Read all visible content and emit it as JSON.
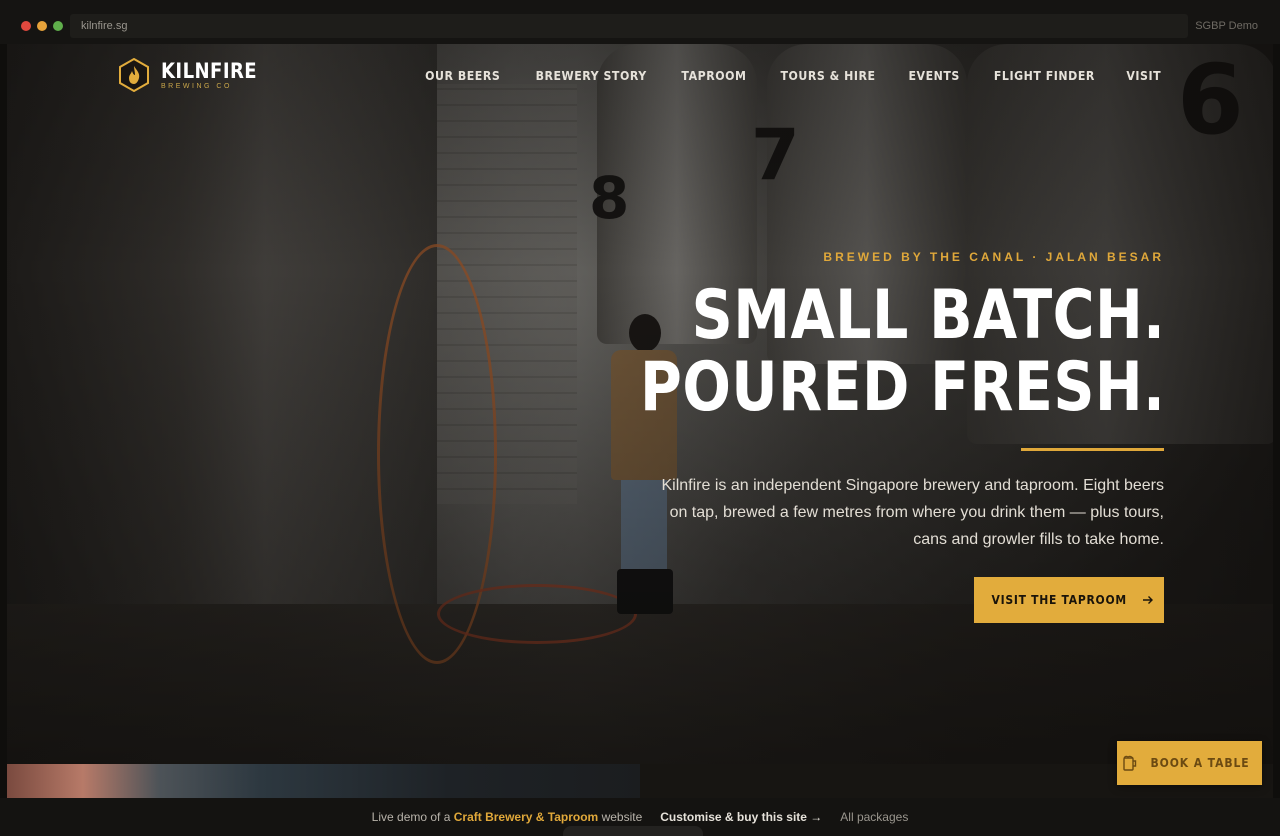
{
  "browser": {
    "url": "kilnfire.sg",
    "label": "SGBP Demo",
    "dots": [
      "#e0483e",
      "#e6a23a",
      "#5fae4b"
    ]
  },
  "brand": {
    "name": "KILNFIRE",
    "sub": "BREWING CO",
    "accent": "#e2ac3c"
  },
  "nav": {
    "items": [
      "OUR BEERS",
      "BREWERY STORY",
      "TAPROOM",
      "TOURS & HIRE",
      "EVENTS",
      "FLIGHT FINDER",
      "VISIT"
    ]
  },
  "hero": {
    "eyebrow": "BREWED BY THE CANAL · JALAN BESAR",
    "headline_line1": "SMALL BATCH.",
    "headline_line2": "POURED FRESH.",
    "lede": "Kilnfire is an independent Singapore brewery and taproom. Eight beers on tap, brewed a few metres from where you drink them — plus tours, cans and growler fills to take home.",
    "cta_label": "VISIT THE TAPROOM",
    "cta_icon": "arrow-right-icon",
    "tank_numbers": [
      "8",
      "7",
      "6"
    ]
  },
  "book": {
    "label": "BOOK A TABLE",
    "icon": "beer-mug-icon"
  },
  "demo_bar": {
    "prefix": "Live demo of a",
    "highlight": "Craft Brewery & Taproom",
    "suffix": "website",
    "buy": "Customise & buy this site →",
    "packages": "All packages"
  }
}
